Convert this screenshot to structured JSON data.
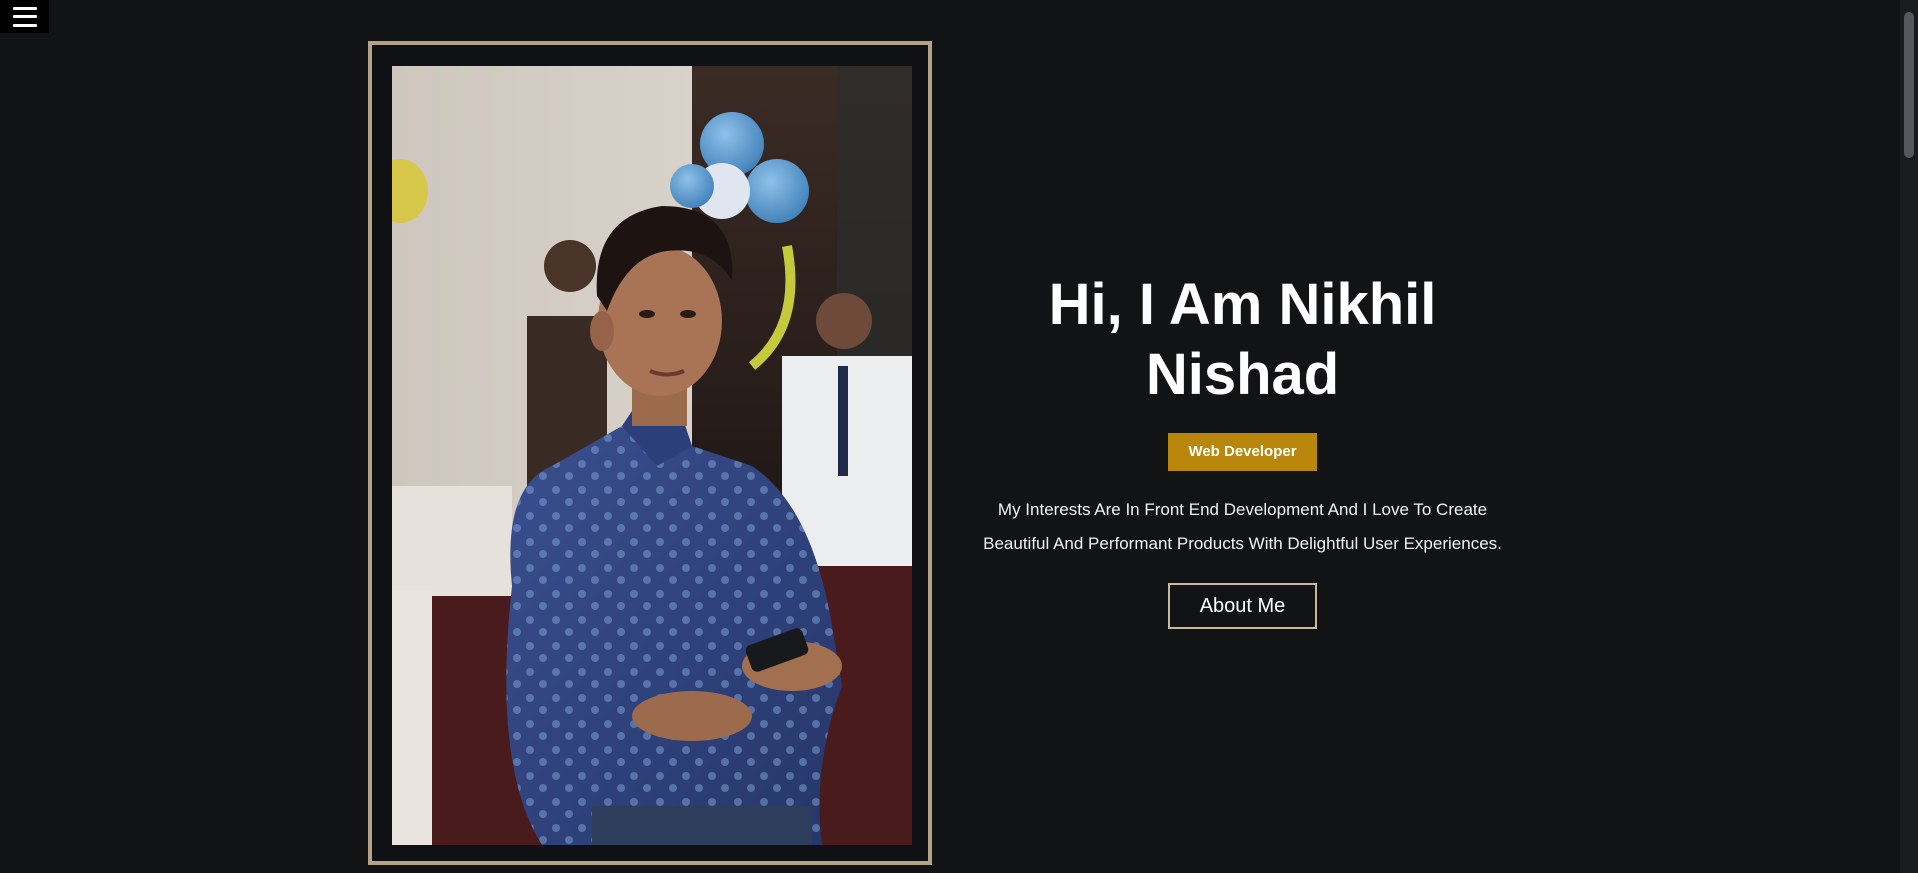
{
  "nav": {
    "menu_icon": "hamburger-menu-icon"
  },
  "hero": {
    "title_line1": "Hi, I Am Nikhil",
    "title_line2": "Nishad",
    "role": "Web Developer",
    "description_line1": "My Interests Are In Front End Development And I Love To Create",
    "description_line2": "Beautiful And Performant Products With Delightful User Experiences.",
    "about_button": "About Me"
  },
  "colors": {
    "background": "#121315",
    "accent": "#b8860b",
    "frame_border": "#b3a18a"
  }
}
